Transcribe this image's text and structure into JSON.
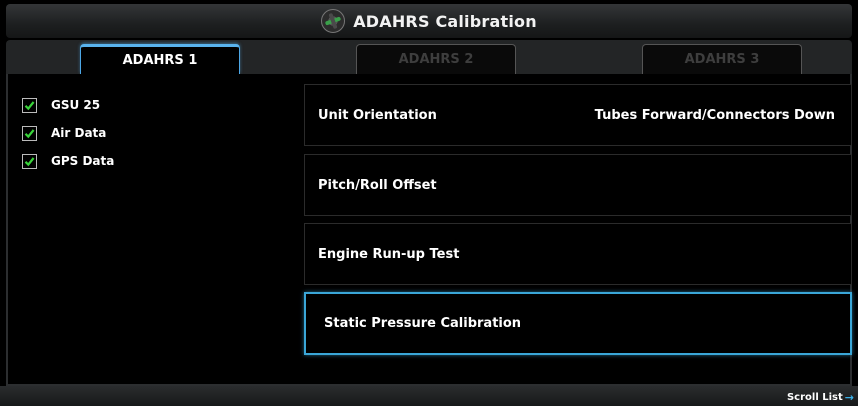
{
  "window": {
    "title": "ADAHRS Calibration",
    "icon": "attitude-indicator-icon"
  },
  "tabs": [
    {
      "label": "ADAHRS 1",
      "active": true
    },
    {
      "label": "ADAHRS 2",
      "active": false
    },
    {
      "label": "ADAHRS 3",
      "active": false
    }
  ],
  "checklist": [
    {
      "label": "GSU 25",
      "checked": true
    },
    {
      "label": "Air Data",
      "checked": true
    },
    {
      "label": "GPS Data",
      "checked": true
    }
  ],
  "menu": [
    {
      "label": "Unit Orientation",
      "value": "Tubes Forward/Connectors Down"
    },
    {
      "label": "Pitch/Roll Offset",
      "value": ""
    },
    {
      "label": "Engine Run-up Test",
      "value": ""
    },
    {
      "label": "Static Pressure Calibration",
      "value": "",
      "selected": true
    }
  ],
  "footer": {
    "scroll_hint": "Scroll List"
  },
  "colors": {
    "accent": "#3aa6d8",
    "check": "#39d33a"
  }
}
